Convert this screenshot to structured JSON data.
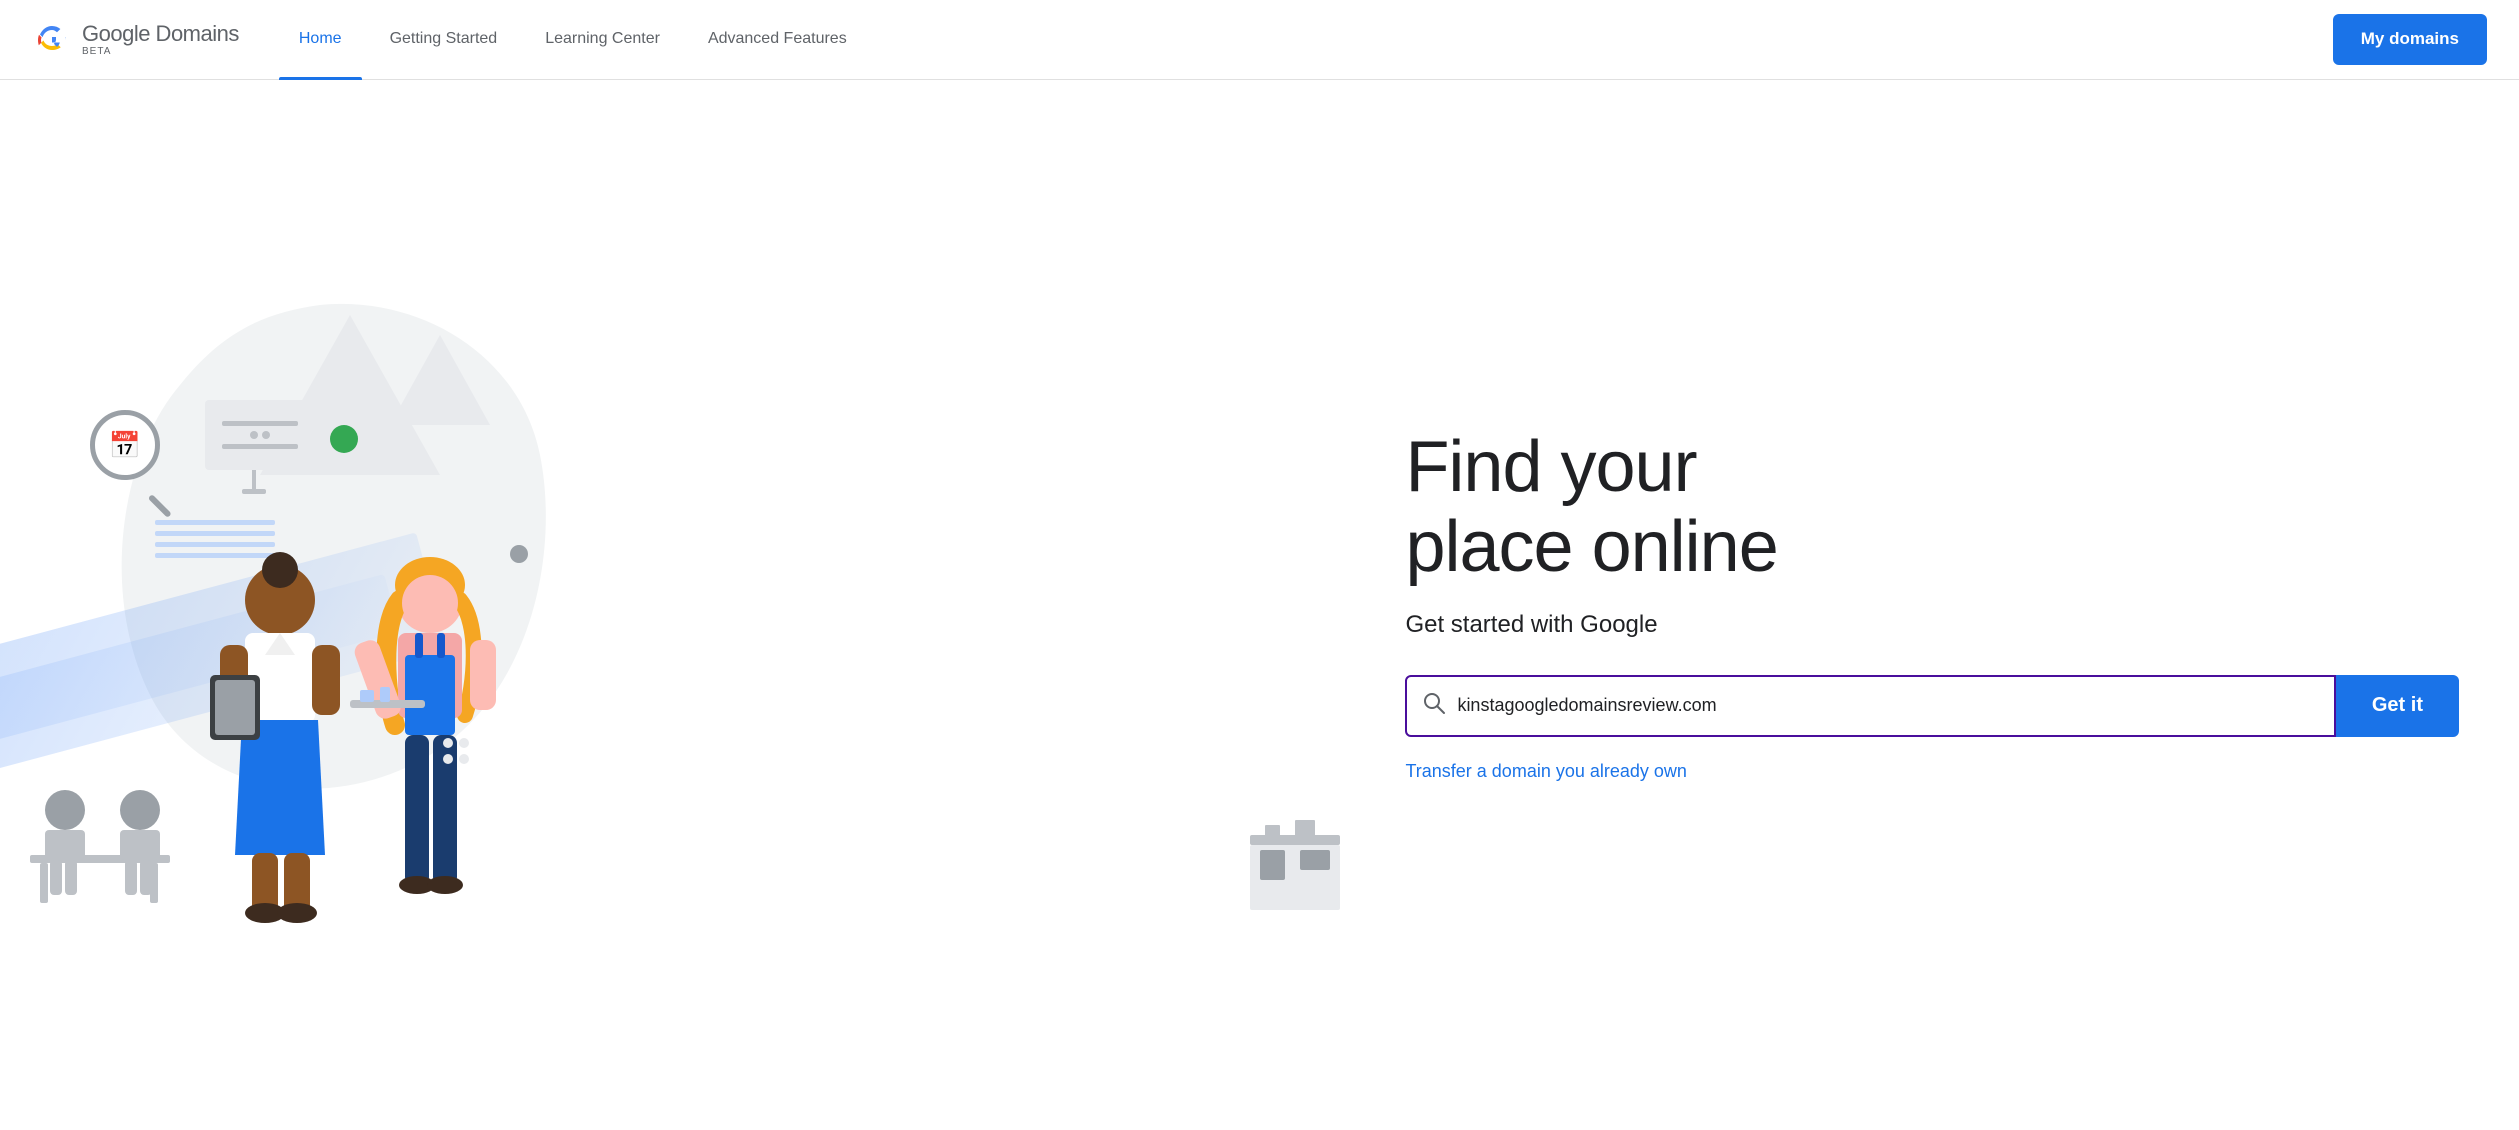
{
  "header": {
    "logo_text": "Google Domains",
    "logo_beta": "BETA",
    "nav": [
      {
        "id": "home",
        "label": "Home",
        "active": true
      },
      {
        "id": "getting-started",
        "label": "Getting Started",
        "active": false
      },
      {
        "id": "learning-center",
        "label": "Learning Center",
        "active": false
      },
      {
        "id": "advanced-features",
        "label": "Advanced Features",
        "active": false
      }
    ],
    "my_domains_label": "My domains"
  },
  "hero": {
    "title_line1": "Find your",
    "title_line2": "place online",
    "subtitle": "Get started with Google"
  },
  "search": {
    "placeholder": "kinstagoogledomainsreview.com",
    "value": "kinstagoogledomainsreview.com",
    "button_label": "Get it",
    "transfer_label": "Transfer a domain you already own"
  },
  "colors": {
    "brand_blue": "#1a73e8",
    "search_border": "#4a0e9c",
    "active_nav": "#1a73e8",
    "text_primary": "#202124",
    "text_secondary": "#5f6368"
  }
}
